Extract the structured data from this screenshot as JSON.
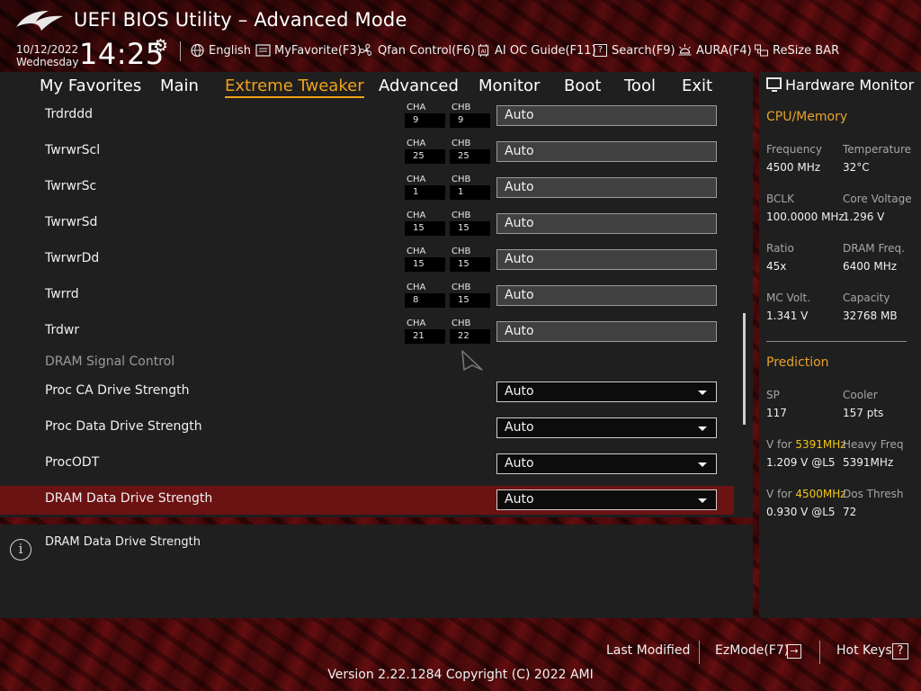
{
  "header": {
    "title": "UEFI BIOS Utility – Advanced Mode",
    "date": "10/12/2022",
    "day": "Wednesday",
    "time": "14:25",
    "toolbar": [
      {
        "icon": "globe-icon",
        "label": "English"
      },
      {
        "icon": "myfavorite-icon",
        "label": "MyFavorite(F3)"
      },
      {
        "icon": "fan-icon",
        "label": "Qfan Control(F6)"
      },
      {
        "icon": "ai-chip-icon",
        "label": "AI OC Guide(F11)"
      },
      {
        "icon": "search-icon",
        "label": "Search(F9)"
      },
      {
        "icon": "aura-icon",
        "label": "AURA(F4)"
      },
      {
        "icon": "resize-bar-icon",
        "label": "ReSize BAR"
      }
    ]
  },
  "tabs": [
    {
      "label": "My Favorites",
      "active": false
    },
    {
      "label": "Main",
      "active": false
    },
    {
      "label": "Extreme Tweaker",
      "active": true
    },
    {
      "label": "Advanced",
      "active": false
    },
    {
      "label": "Monitor",
      "active": false
    },
    {
      "label": "Boot",
      "active": false
    },
    {
      "label": "Tool",
      "active": false
    },
    {
      "label": "Exit",
      "active": false
    }
  ],
  "timings": [
    {
      "label": "Trdrddd",
      "cha_label": "CHA",
      "cha": "9",
      "chb_label": "CHB",
      "chb": "9",
      "value": "Auto"
    },
    {
      "label": "TwrwrScl",
      "cha_label": "CHA",
      "cha": "25",
      "chb_label": "CHB",
      "chb": "25",
      "value": "Auto"
    },
    {
      "label": "TwrwrSc",
      "cha_label": "CHA",
      "cha": "1",
      "chb_label": "CHB",
      "chb": "1",
      "value": "Auto"
    },
    {
      "label": "TwrwrSd",
      "cha_label": "CHA",
      "cha": "15",
      "chb_label": "CHB",
      "chb": "15",
      "value": "Auto"
    },
    {
      "label": "TwrwrDd",
      "cha_label": "CHA",
      "cha": "15",
      "chb_label": "CHB",
      "chb": "15",
      "value": "Auto"
    },
    {
      "label": "Twrrd",
      "cha_label": "CHA",
      "cha": "8",
      "chb_label": "CHB",
      "chb": "15",
      "value": "Auto"
    },
    {
      "label": "Trdwr",
      "cha_label": "CHA",
      "cha": "21",
      "chb_label": "CHB",
      "chb": "22",
      "value": "Auto"
    }
  ],
  "section_header": "DRAM Signal Control",
  "dropdowns": [
    {
      "label": "Proc CA Drive Strength",
      "value": "Auto",
      "selected": false
    },
    {
      "label": "Proc Data Drive Strength",
      "value": "Auto",
      "selected": false
    },
    {
      "label": "ProcODT",
      "value": "Auto",
      "selected": false
    },
    {
      "label": "DRAM Data Drive Strength",
      "value": "Auto",
      "selected": true
    }
  ],
  "help": {
    "text": "DRAM Data Drive Strength"
  },
  "hardware_monitor": {
    "title": "Hardware Monitor",
    "cpu_memory": {
      "heading": "CPU/Memory",
      "items": [
        {
          "label": "Frequency",
          "value": "4500 MHz"
        },
        {
          "label": "Temperature",
          "value": "32°C"
        },
        {
          "label": "BCLK",
          "value": "100.0000 MHz"
        },
        {
          "label": "Core Voltage",
          "value": "1.296 V"
        },
        {
          "label": "Ratio",
          "value": "45x"
        },
        {
          "label": "DRAM Freq.",
          "value": "6400 MHz"
        },
        {
          "label": "MC Volt.",
          "value": "1.341 V"
        },
        {
          "label": "Capacity",
          "value": "32768 MB"
        }
      ]
    },
    "prediction": {
      "heading": "Prediction",
      "sp_label": "SP",
      "sp_value": "117",
      "cooler_label": "Cooler",
      "cooler_value": "157 pts",
      "v1_prefix": "V for ",
      "v1_freq": "5391MHz",
      "v1_value": "1.209 V @L5",
      "heavy_label": "Heavy Freq",
      "heavy_value": "5391MHz",
      "v2_prefix": "V for ",
      "v2_freq": "4500MHz",
      "v2_value": "0.930 V @L5",
      "dos_label": "Dos Thresh",
      "dos_value": "72"
    }
  },
  "footer": {
    "last_modified": "Last Modified",
    "ezmode": "EzMode(F7)",
    "ezmode_icon": "→",
    "hotkeys": "Hot Keys",
    "hotkeys_icon": "?",
    "version": "Version 2.22.1284 Copyright (C) 2022 AMI"
  },
  "colors": {
    "accent": "#f0a21a",
    "highlight_row": "#6b1213",
    "prediction_yellow": "#f2c518"
  }
}
